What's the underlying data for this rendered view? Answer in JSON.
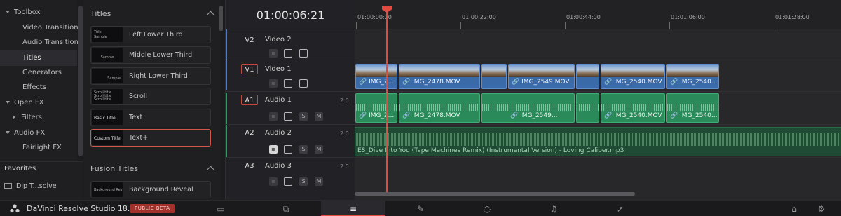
{
  "toolbox": {
    "header": "Toolbox",
    "items": [
      "Video Transitions",
      "Audio Transitions",
      "Titles",
      "Generators",
      "Effects"
    ],
    "open_fx": "Open FX",
    "filters": "Filters",
    "audio_fx": "Audio FX",
    "fairlight_fx": "Fairlight FX"
  },
  "favorites": {
    "header": "Favorites",
    "item": "Dip T...solve"
  },
  "titles_panel": {
    "header": "Titles",
    "items": [
      {
        "name": "Left Lower Third",
        "thumb": "Title\nSample"
      },
      {
        "name": "Middle Lower Third",
        "thumb": "Sample"
      },
      {
        "name": "Right Lower Third",
        "thumb": "Sample"
      },
      {
        "name": "Scroll",
        "thumb": "Scroll title"
      },
      {
        "name": "Text",
        "thumb": "Basic Title"
      },
      {
        "name": "Text+",
        "thumb": "Custom Title"
      }
    ],
    "fusion_header": "Fusion Titles",
    "fusion_items": [
      {
        "name": "Background Reveal",
        "thumb": "Background Reveal"
      }
    ]
  },
  "timecode": "01:00:06:21",
  "ruler": [
    "01:00:00:00",
    "01:00:22:00",
    "01:00:44:00",
    "01:01:06:00",
    "01:01:28:00"
  ],
  "tracks": {
    "v2": {
      "id": "V2",
      "name": "Video 2"
    },
    "v1": {
      "id": "V1",
      "name": "Video 1"
    },
    "a1": {
      "id": "A1",
      "name": "Audio 1",
      "ch": "2.0"
    },
    "a2": {
      "id": "A2",
      "name": "Audio 2",
      "ch": "2.0"
    },
    "a3": {
      "id": "A3",
      "name": "Audio 3",
      "ch": "2.0"
    },
    "s": "S",
    "m": "M"
  },
  "video_clips": [
    "IMG_2...",
    "IMG_2478.MOV",
    "IMG_2549.MOV",
    "IMG_2540.MOV",
    "IMG_2540..."
  ],
  "audio_clips": [
    "IMG_2...",
    "IMG_2478.MOV",
    "IMG_2549...",
    "IMG_2540.MOV",
    "IMG_2540..."
  ],
  "music_clip": "ES_Dive Into You (Tape Machines Remix) (Instrumental Version) - Loving Caliber.mp3",
  "bottom": {
    "app": "DaVinci Resolve Studio 18.5",
    "badge": "PUBLIC BETA"
  },
  "colors": {
    "accent": "#e04a3f",
    "video": "#3a6aa8",
    "audio": "#2a8a5a"
  }
}
